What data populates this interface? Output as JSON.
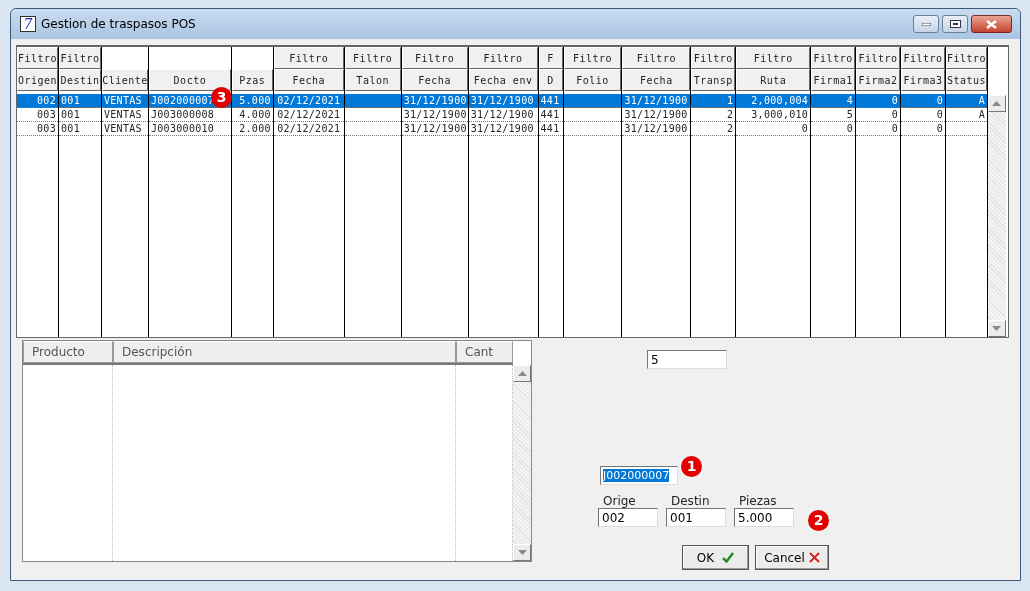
{
  "window": {
    "title": "Gestion de traspasos POS",
    "logo": "7"
  },
  "grid": {
    "columns": [
      {
        "filter": "Filtro",
        "label": "Origen"
      },
      {
        "filter": "Filtro",
        "label": "Destin"
      },
      {
        "label": "Cliente"
      },
      {
        "label": "Docto"
      },
      {
        "label": "Pzas"
      },
      {
        "filter": "Filtro",
        "label": "Fecha"
      },
      {
        "filter": "Filtro",
        "label": "Talon"
      },
      {
        "filter": "Filtro",
        "label": "Fecha"
      },
      {
        "filter": "Filtro",
        "label": "Fecha env"
      },
      {
        "filter": "F",
        "label": "D"
      },
      {
        "filter": "Filtro",
        "label": "Folio"
      },
      {
        "filter": "Filtro",
        "label": "Fecha"
      },
      {
        "filter": "Filtro",
        "label": "Transp"
      },
      {
        "filter": "Filtro",
        "label": "Ruta"
      },
      {
        "filter": "Filtro",
        "label": "Firma1"
      },
      {
        "filter": "Filtro",
        "label": "Firma2"
      },
      {
        "filter": "Filtro",
        "label": "Firma3"
      },
      {
        "filter": "Filtro",
        "label": "Status"
      }
    ],
    "rows": [
      {
        "selected": true,
        "cells": [
          "002",
          "001",
          "VENTAS",
          "J002000007",
          "5.000",
          "02/12/2021",
          null,
          "31/12/1900",
          "31/12/1900",
          "441",
          null,
          "31/12/1900",
          "1",
          "2,000,004",
          "4",
          "0",
          "0",
          "A"
        ]
      },
      {
        "selected": false,
        "cells": [
          "003",
          "001",
          "VENTAS",
          "J003000008",
          "4.000",
          "02/12/2021",
          null,
          "31/12/1900",
          "31/12/1900",
          "441",
          null,
          "31/12/1900",
          "2",
          "3,000,010",
          "5",
          "0",
          "0",
          "A"
        ]
      },
      {
        "selected": false,
        "cells": [
          "003",
          "001",
          "VENTAS",
          "J003000010",
          "2.000",
          "02/12/2021",
          null,
          "31/12/1900",
          "31/12/1900",
          "441",
          null,
          "31/12/1900",
          "2",
          "0",
          "0",
          "0",
          "0",
          null
        ]
      }
    ]
  },
  "products": {
    "columns": [
      "Producto",
      "Descripción",
      "Cant"
    ]
  },
  "count_field": {
    "value": "5"
  },
  "doc_field": {
    "value": "J002000007"
  },
  "fields": [
    {
      "label": "Orige",
      "value": "002"
    },
    {
      "label": "Destin",
      "value": "001"
    },
    {
      "label": "Piezas",
      "value": "5.000"
    }
  ],
  "buttons": [
    {
      "label": "OK",
      "kind": "ok"
    },
    {
      "label": "Cancel",
      "kind": "cancel"
    }
  ],
  "markers": [
    "1",
    "2",
    "3"
  ]
}
